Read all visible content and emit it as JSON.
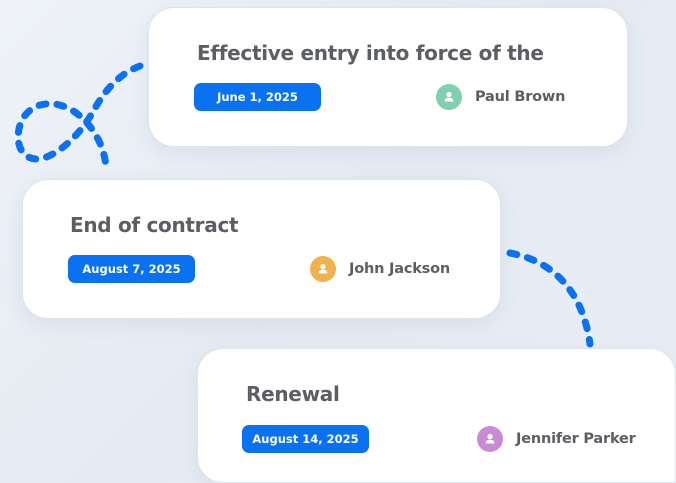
{
  "colors": {
    "accent": "#0a72f0",
    "dash": "#0a72f0",
    "title_text": "#5b5e63",
    "card_bg": "#ffffff"
  },
  "milestones": [
    {
      "title": "Effective entry into force of the",
      "date": "June 1, 2025",
      "person": "Paul Brown",
      "avatar_color": "#7fd0b0",
      "avatar_icon": "user-icon"
    },
    {
      "title": "End of contract",
      "date": "August 7, 2025",
      "person": "John Jackson",
      "avatar_color": "#f0b24c",
      "avatar_icon": "user-icon"
    },
    {
      "title": "Renewal",
      "date": "August 14, 2025",
      "person": "Jennifer Parker",
      "avatar_color": "#c98ad6",
      "avatar_icon": "user-icon"
    }
  ]
}
